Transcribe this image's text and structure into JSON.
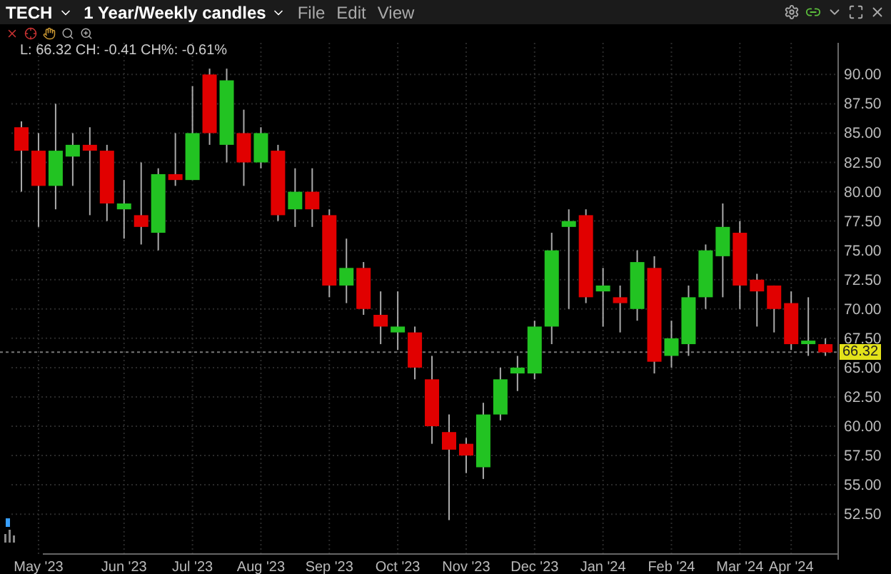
{
  "title_bar": {
    "symbol": "TECH",
    "timeframe": "1 Year/Weekly candles",
    "menu": [
      "File",
      "Edit",
      "View"
    ]
  },
  "quote_line": "L: 66.32 CH: -0.41 CH%: -0.61%",
  "chart": {
    "chart_data": {
      "type": "candlestick",
      "categories": [
        null,
        "May '23",
        null,
        null,
        null,
        null,
        "Jun '23",
        null,
        null,
        null,
        "Jul '23",
        null,
        null,
        null,
        "Aug '23",
        null,
        null,
        null,
        "Sep '23",
        null,
        null,
        null,
        "Oct '23",
        null,
        null,
        null,
        "Nov '23",
        null,
        null,
        null,
        "Dec '23",
        null,
        null,
        null,
        "Jan '24",
        null,
        null,
        null,
        "Feb '24",
        null,
        null,
        null,
        "Mar '24",
        null,
        null,
        "Apr '24",
        null,
        null
      ],
      "ohlc": [
        [
          85.5,
          86,
          80,
          83.5
        ],
        [
          83.5,
          85,
          77,
          80.5
        ],
        [
          80.5,
          87.5,
          78.5,
          83.5
        ],
        [
          83,
          85,
          80.5,
          84
        ],
        [
          84,
          85.5,
          78,
          83.5
        ],
        [
          83.5,
          84,
          77.5,
          79
        ],
        [
          78.5,
          81,
          76,
          79
        ],
        [
          78,
          82.5,
          75.5,
          77
        ],
        [
          76.5,
          82,
          75,
          81.5
        ],
        [
          81.5,
          85,
          80.5,
          81
        ],
        [
          81,
          89,
          81,
          85
        ],
        [
          90,
          90.5,
          84,
          85
        ],
        [
          84,
          90.5,
          82.5,
          89.5
        ],
        [
          85,
          87,
          80.5,
          82.5
        ],
        [
          82.5,
          85.5,
          82,
          85
        ],
        [
          83.5,
          84,
          77.5,
          78
        ],
        [
          78.5,
          82,
          77,
          80
        ],
        [
          80,
          82,
          77,
          78.5
        ],
        [
          78,
          78.5,
          71,
          72
        ],
        [
          72,
          76,
          70.5,
          73.5
        ],
        [
          73.5,
          74,
          69.5,
          70
        ],
        [
          69.5,
          71.5,
          67,
          68.5
        ],
        [
          68,
          71.5,
          66.5,
          68.5
        ],
        [
          68,
          68.5,
          64,
          65
        ],
        [
          64,
          66,
          58.5,
          60
        ],
        [
          59.5,
          61,
          52,
          58
        ],
        [
          58.5,
          59,
          56,
          57.5
        ],
        [
          56.5,
          62,
          55.5,
          61
        ],
        [
          61,
          65,
          60.5,
          64
        ],
        [
          64.5,
          66,
          63,
          65
        ],
        [
          64.5,
          69,
          64,
          68.5
        ],
        [
          68.5,
          76.5,
          67,
          75
        ],
        [
          77,
          78.5,
          70,
          77.5
        ],
        [
          78,
          78.5,
          70.5,
          71
        ],
        [
          71.5,
          73.5,
          68.5,
          72
        ],
        [
          71,
          72,
          68,
          70.5
        ],
        [
          70,
          75,
          69,
          74
        ],
        [
          73.5,
          74.5,
          64.5,
          65.5
        ],
        [
          66,
          69,
          65,
          67.5
        ],
        [
          67,
          72,
          66,
          71
        ],
        [
          71,
          75.5,
          70,
          75
        ],
        [
          74.5,
          79,
          71,
          77
        ],
        [
          76.5,
          77.5,
          70,
          72
        ],
        [
          72.5,
          73,
          68.5,
          71.5
        ],
        [
          72,
          72,
          68,
          70
        ],
        [
          70.5,
          71.5,
          66.5,
          67
        ],
        [
          67,
          71,
          66,
          67.3
        ],
        [
          67,
          67.5,
          66,
          66.3
        ]
      ],
      "ylim": [
        49.1,
        92.7
      ],
      "grid": true,
      "ref_lines": [
        {
          "axis": "y",
          "value": 66.32,
          "label": "66.32"
        }
      ],
      "yticks": [
        {
          "value": 52.5,
          "label": "52.50"
        },
        {
          "value": 55,
          "label": "55.00"
        },
        {
          "value": 57.5,
          "label": "57.50"
        },
        {
          "value": 60,
          "label": "60.00"
        },
        {
          "value": 62.5,
          "label": "62.50"
        },
        {
          "value": 65,
          "label": "65.00"
        },
        {
          "value": 67.5,
          "label": "67.50"
        },
        {
          "value": 70,
          "label": "70.00"
        },
        {
          "value": 72.5,
          "label": "72.50"
        },
        {
          "value": 75,
          "label": "75.00"
        },
        {
          "value": 77.5,
          "label": "77.50"
        },
        {
          "value": 80,
          "label": "80.00"
        },
        {
          "value": 82.5,
          "label": "82.50"
        },
        {
          "value": 85,
          "label": "85.00"
        },
        {
          "value": 87.5,
          "label": "87.50"
        },
        {
          "value": 90,
          "label": "90.00"
        }
      ]
    }
  }
}
